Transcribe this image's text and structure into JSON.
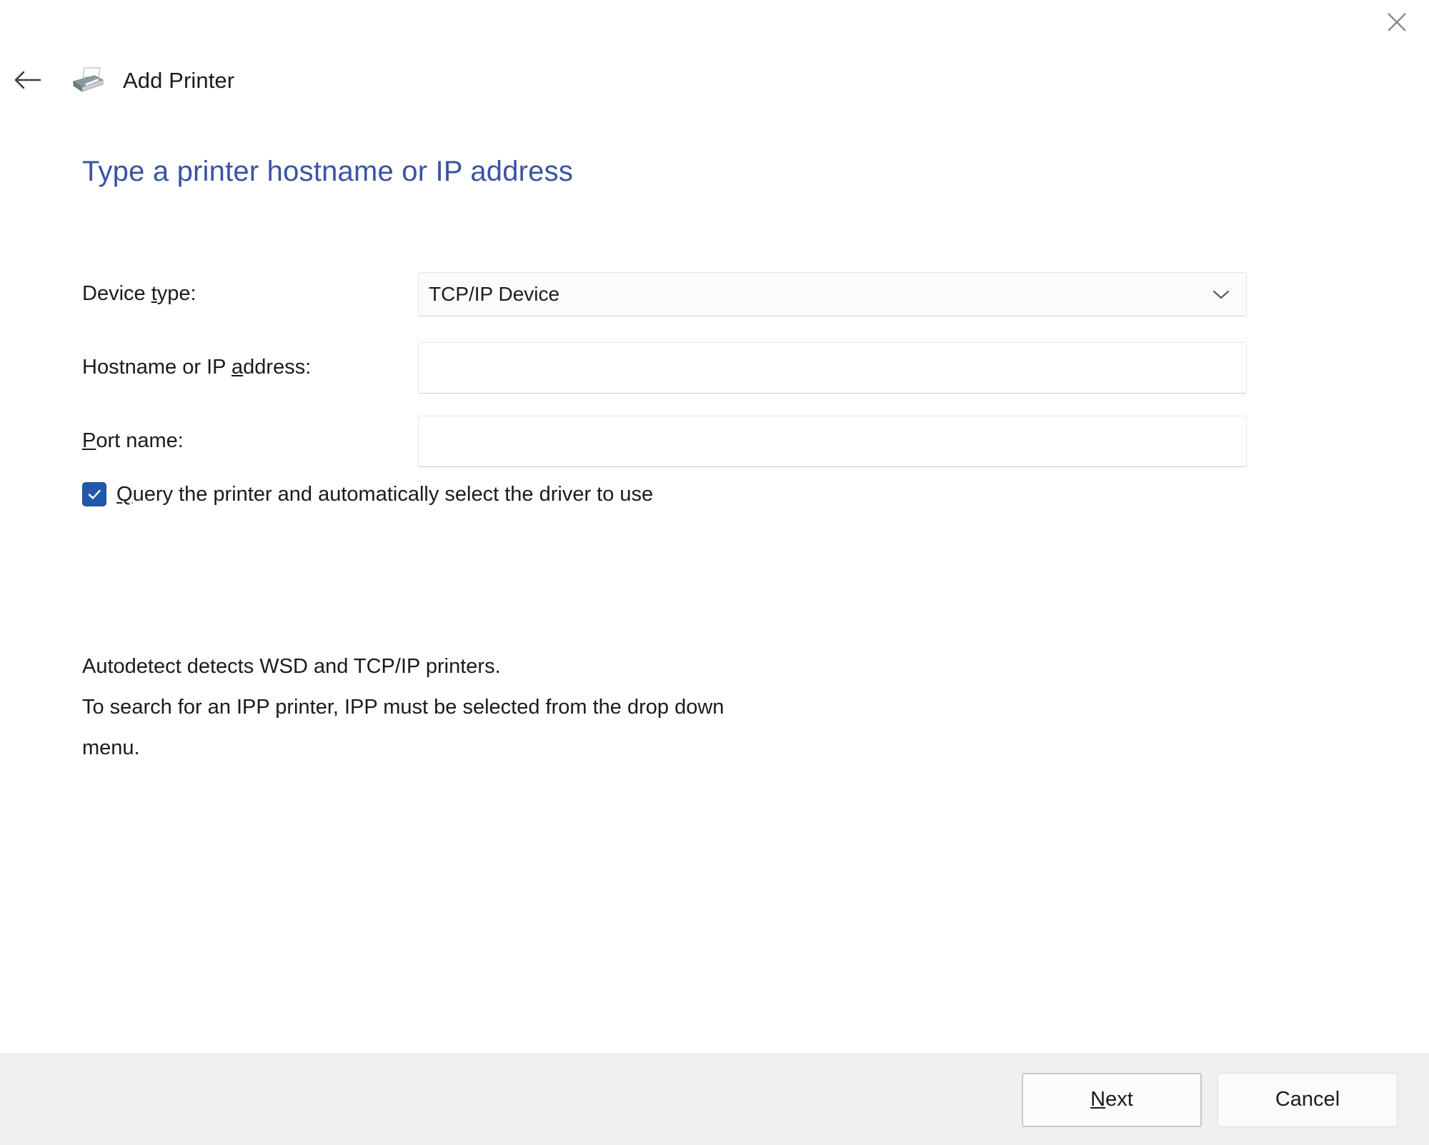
{
  "window": {
    "title": "Add Printer",
    "close_label": "Close",
    "back_label": "Back",
    "printer_icon": "printer-icon",
    "back_icon": "arrow-left-icon",
    "close_icon": "close-icon"
  },
  "page": {
    "heading": "Type a printer hostname or IP address",
    "heading_color": "#3a53a4"
  },
  "form": {
    "rows": [
      {
        "label_prefix": "Device ",
        "label_accesskey": "t",
        "label_suffix": "ype:",
        "control": "combobox",
        "value": "TCP/IP Device",
        "chevron_icon": "chevron-down-icon"
      },
      {
        "label_prefix": "Hostname or IP ",
        "label_accesskey": "a",
        "label_suffix": "ddress:",
        "control": "textinput",
        "value": "",
        "placeholder": ""
      },
      {
        "label_prefix": "",
        "label_accesskey": "P",
        "label_suffix": "ort name:",
        "control": "textinput",
        "value": "",
        "placeholder": ""
      }
    ]
  },
  "checkbox": {
    "checked": true,
    "checked_color": "#2159a8",
    "check_icon": "checkmark-icon",
    "label_prefix": "",
    "label_accesskey": "Q",
    "label_suffix": "uery the printer and automatically select the driver to use"
  },
  "help": {
    "line1": "Autodetect detects WSD and TCP/IP printers.",
    "line2": "To search for an IPP printer, IPP must be selected from the drop down",
    "line3": "menu."
  },
  "footer": {
    "next_prefix": "",
    "next_accesskey": "N",
    "next_suffix": "ext",
    "cancel_label": "Cancel"
  }
}
